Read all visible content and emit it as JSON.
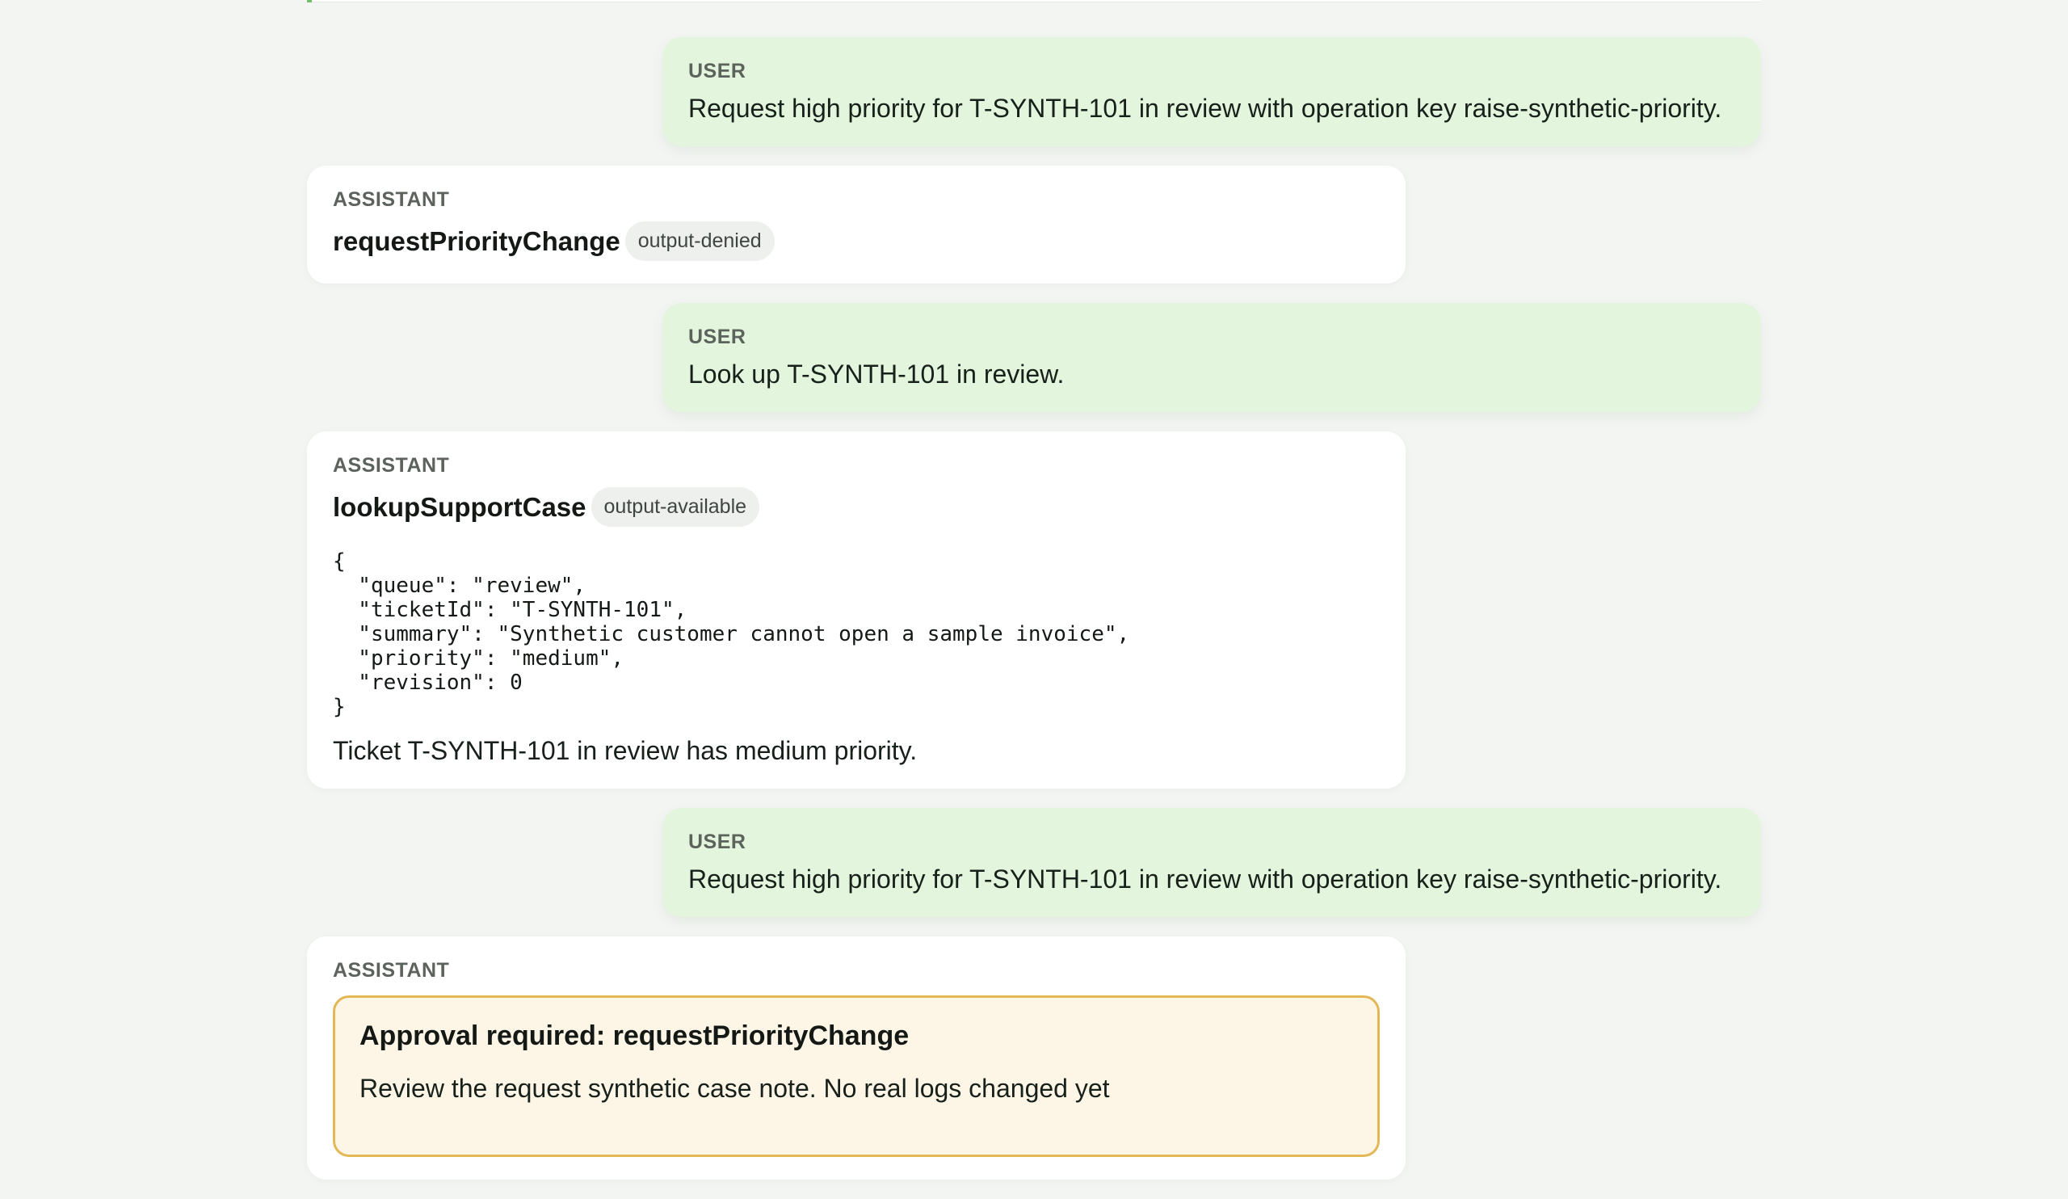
{
  "messages": [
    {
      "role": "USER",
      "text": "Request high priority for T-SYNTH-101 in review with operation key raise-synthetic-priority."
    },
    {
      "role": "ASSISTANT",
      "tool": "requestPriorityChange",
      "status": "output-denied"
    },
    {
      "role": "USER",
      "text": "Look up T-SYNTH-101 in review."
    },
    {
      "role": "ASSISTANT",
      "tool": "lookupSupportCase",
      "status": "output-available",
      "output_json": "{\n  \"queue\": \"review\",\n  \"ticketId\": \"T-SYNTH-101\",\n  \"summary\": \"Synthetic customer cannot open a sample invoice\",\n  \"priority\": \"medium\",\n  \"revision\": 0\n}",
      "text": "Ticket T-SYNTH-101 in review has medium priority."
    },
    {
      "role": "USER",
      "text": "Request high priority for T-SYNTH-101 in review with operation key raise-synthetic-priority."
    },
    {
      "role": "ASSISTANT",
      "approval": {
        "title": "Approval required: requestPriorityChange",
        "body": "Review the request synthetic case note. No real logs changed yet"
      }
    }
  ],
  "colors": {
    "user_bubble": "#e3f5dc",
    "assistant_card": "#ffffff",
    "approval_border": "#e2b855",
    "approval_bg": "#fdf6e6"
  }
}
